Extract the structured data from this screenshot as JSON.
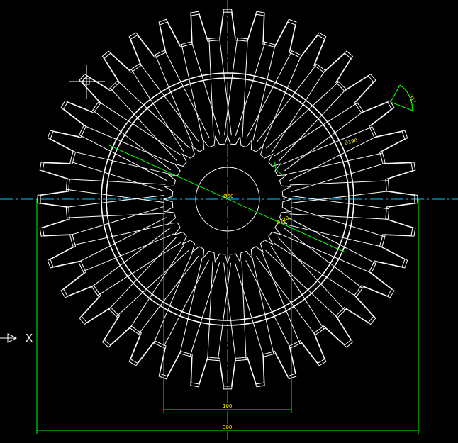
{
  "drawing": {
    "background_color": "#000000",
    "geometry_color": "#ffffff",
    "centerline_color": "#00c8ff",
    "dimension_color": "#00ff00",
    "dimension_text_color": "#ffff00",
    "outer_gear_teeth": 36,
    "inner_gear_teeth": 32
  },
  "dimensions": {
    "bore_diameter": "Ø50",
    "ring_diameter": "Ø190",
    "inner_gear_diameter": "Ø120",
    "small_width": "100",
    "overall_width": "300",
    "tooth_angle": "31°"
  },
  "ucs": {
    "axis_label": "X",
    "icon": "ucs-x-arrow-icon"
  },
  "cursor": {
    "icon": "crosshair-cursor-icon"
  }
}
